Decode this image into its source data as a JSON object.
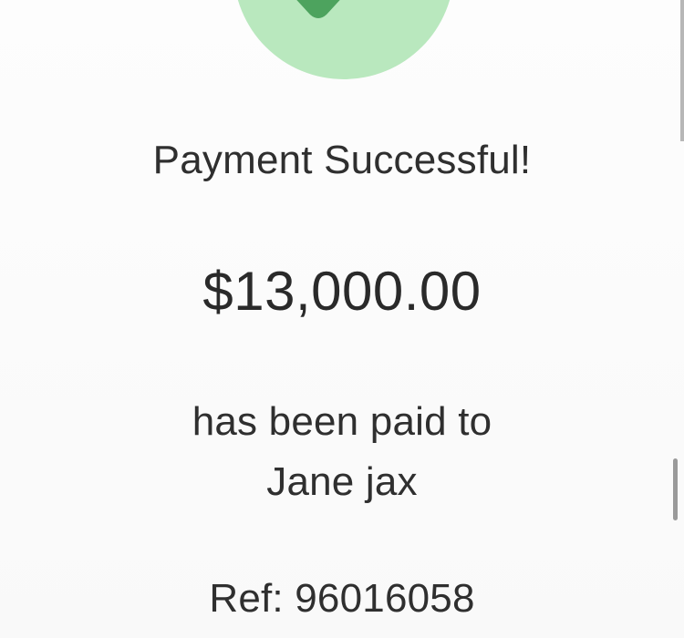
{
  "payment": {
    "status_title": "Payment Successful!",
    "amount": "$13,000.00",
    "paid_line": "has been paid to",
    "payee": "Jane jax",
    "reference": "Ref: 96016058"
  },
  "icons": {
    "status": "check-icon"
  },
  "colors": {
    "success_circle": "#b9e8be",
    "check_mark": "#4da35e",
    "text": "#2f2f2f",
    "background": "#fbfbfb",
    "scrollbar": "#9a9a9a"
  }
}
